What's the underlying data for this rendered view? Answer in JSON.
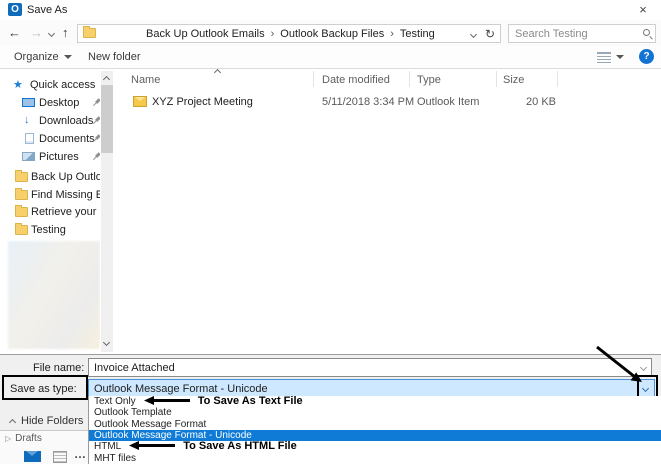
{
  "window": {
    "title": "Save As"
  },
  "glyphs": {
    "outlook_letter": "O",
    "close": "×",
    "back": "←",
    "forward": "→",
    "up": "↑",
    "refresh": "↻",
    "breadcrumb_sep": "›",
    "star": "★",
    "download_arrow": "↓",
    "help": "?",
    "expander": "▷",
    "more_dots": "…"
  },
  "navbar": {
    "breadcrumb": [
      "Back Up Outlook Emails",
      "Outlook Backup Files",
      "Testing"
    ],
    "search_placeholder": "Search Testing"
  },
  "toolbar": {
    "organize_label": "Organize",
    "new_folder_label": "New folder"
  },
  "sidebar": {
    "items": [
      {
        "label": "Quick access",
        "icon": "star"
      },
      {
        "label": "Desktop",
        "icon": "desktop",
        "pinned": true
      },
      {
        "label": "Downloads",
        "icon": "download-arrow",
        "pinned": true
      },
      {
        "label": "Documents",
        "icon": "document",
        "pinned": true
      },
      {
        "label": "Pictures",
        "icon": "pictures",
        "pinned": true
      },
      {
        "label": "Back Up Outlook",
        "icon": "folder"
      },
      {
        "label": "Find Missing Em",
        "icon": "folder"
      },
      {
        "label": "Retrieve your De",
        "icon": "folder"
      },
      {
        "label": "Testing",
        "icon": "folder"
      }
    ]
  },
  "file_list": {
    "columns": [
      "Name",
      "Date modified",
      "Type",
      "Size"
    ],
    "rows": [
      {
        "name": "XYZ Project Meeting",
        "date_modified": "5/11/2018 3:34 PM",
        "type": "Outlook Item",
        "size": "20 KB"
      }
    ]
  },
  "footer": {
    "file_name_label": "File name:",
    "file_name_value": "Invoice Attached",
    "save_as_type_label": "Save as type:",
    "save_as_type_value": "Outlook Message Format - Unicode",
    "hide_folders_label": "Hide Folders"
  },
  "type_dropdown": {
    "options": [
      "Text Only",
      "Outlook Template",
      "Outlook Message Format",
      "Outlook Message Format - Unicode",
      "HTML",
      "MHT files"
    ],
    "selected_index": 3,
    "annotations": {
      "text_only_note": "To Save As Text File",
      "html_note": "To Save As HTML File"
    }
  },
  "background_app": {
    "drafts_label": "Drafts"
  },
  "colors": {
    "accent_blue": "#0f7bd7",
    "combo_highlight": "#cde8ff",
    "folder_yellow": "#f7d06b",
    "outlook_blue": "#0f6cbd"
  }
}
